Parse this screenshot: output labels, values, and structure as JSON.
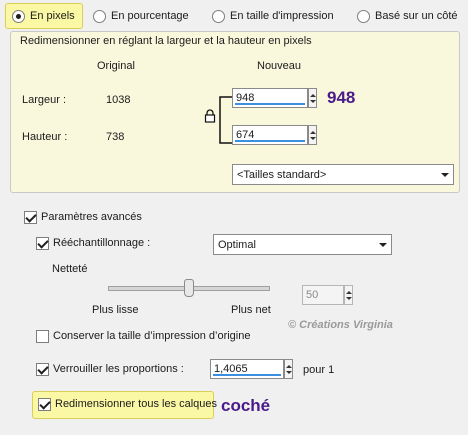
{
  "radios": [
    {
      "label": "En pixels",
      "selected": true
    },
    {
      "label": "En pourcentage",
      "selected": false
    },
    {
      "label": "En taille d'impression",
      "selected": false
    },
    {
      "label": "Basé sur un côté",
      "selected": false
    }
  ],
  "group": {
    "title": "Redimensionner en réglant la largeur et la hauteur en pixels",
    "col_original": "Original",
    "col_new": "Nouveau",
    "width_label": "Largeur :",
    "width_original": "1038",
    "width_new": "948",
    "height_label": "Hauteur :",
    "height_original": "738",
    "height_new": "674",
    "size_preset": "<Tailles standard>",
    "annotation_width": "948"
  },
  "advanced": {
    "label": "Paramètres avancés",
    "checked": true,
    "resample_label": "Rééchantillonnage :",
    "resample_checked": true,
    "resample_value": "Optimal",
    "sharpness_label": "Netteté",
    "slider_min_label": "Plus lisse",
    "slider_max_label": "Plus net",
    "sharpness_value": "50",
    "keep_print_size_label": "Conserver la taille d’impression d’origine",
    "keep_print_size_checked": false,
    "lock_ratio_label": "Verrouiller les proportions :",
    "lock_ratio_checked": true,
    "ratio_value": "1,4065",
    "ratio_suffix": "pour 1",
    "resize_layers_label": "Redimensionner tous les calques",
    "resize_layers_checked": true,
    "annotation_checked": "coché"
  },
  "watermark": "© Créations Virginia",
  "colors": {
    "highlight": "#faf8a4",
    "annotation": "#4a1a8a",
    "accent": "#3b8fe0"
  }
}
